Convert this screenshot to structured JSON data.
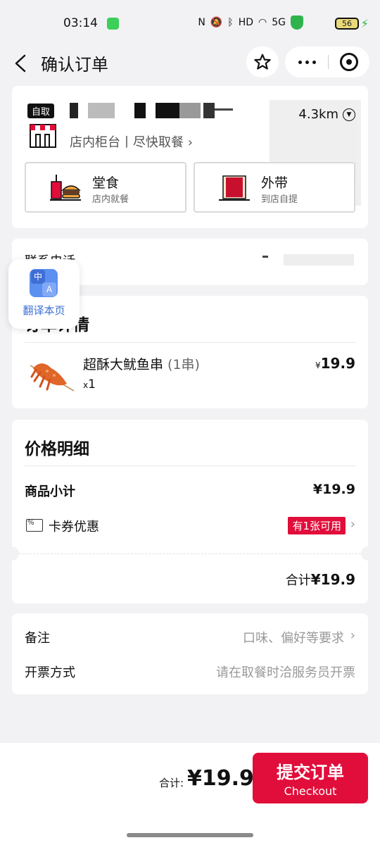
{
  "status_bar": {
    "time": "03:14",
    "network": "5G",
    "battery": "56"
  },
  "header": {
    "title": "确认订单"
  },
  "store": {
    "pickup_tag": "自取",
    "distance": "4.3km",
    "pickup_info": "店内柜台丨尽快取餐 ›",
    "modes": [
      {
        "title": "堂食",
        "subtitle": "店内就餐"
      },
      {
        "title": "外带",
        "subtitle": "到店自提"
      }
    ]
  },
  "contact": {
    "label": "联系电话"
  },
  "translate": {
    "label": "翻译本页"
  },
  "order_detail": {
    "title": "订单详情",
    "items": [
      {
        "name": "超酥大鱿鱼串",
        "unit": " (1串)",
        "qty_prefix": "x",
        "qty": "1",
        "currency": "¥",
        "price": "19.9"
      }
    ]
  },
  "price_detail": {
    "title": "价格明细",
    "subtotal_label": "商品小计",
    "subtotal_value": "¥19.9",
    "coupon_label": "卡券优惠",
    "coupon_badge": "有1张可用",
    "total_prefix": "合计",
    "total_value": "¥19.9"
  },
  "notes": {
    "remark_label": "备注",
    "remark_placeholder": "口味、偏好等要求",
    "invoice_label": "开票方式",
    "invoice_value": "请在取餐时洽服务员开票"
  },
  "bottom_bar": {
    "total_prefix": "合计:",
    "total_amount": "¥19.9",
    "checkout_cn": "提交订单",
    "checkout_en": "Checkout"
  },
  "colors": {
    "brand_red": "#e10d3a",
    "background": "#f2f2f4",
    "translate_blue": "#3b6fd8"
  }
}
